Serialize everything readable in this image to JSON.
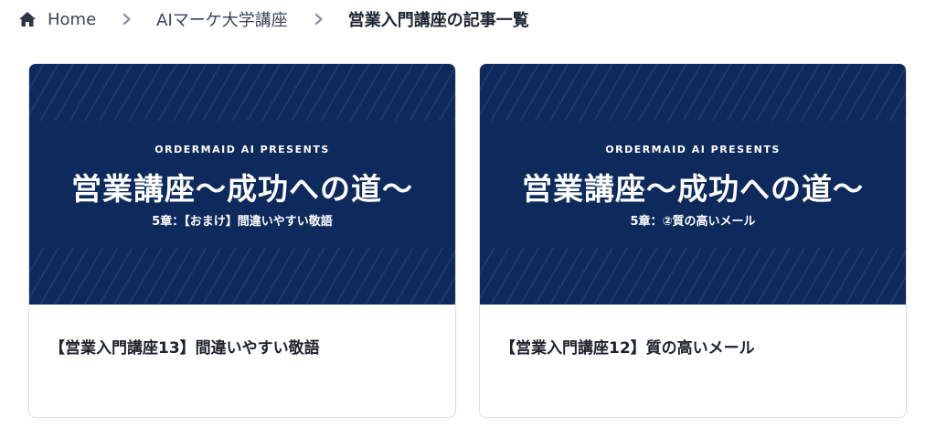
{
  "breadcrumb": {
    "home": "Home",
    "level1": "AIマーケ大学講座",
    "current": "営業入門講座の記事一覧"
  },
  "colors": {
    "thumbnail_bg": "#0e2a5c",
    "card_border": "#dcdfe4",
    "text": "#1e2229"
  },
  "cards": [
    {
      "presents": "ORDERMAID AI PRESENTS",
      "series": "営業講座〜成功への道〜",
      "chapter": "5章：【おまけ】間違いやすい敬語",
      "title": "【営業入門講座13】間違いやすい敬語"
    },
    {
      "presents": "ORDERMAID AI PRESENTS",
      "series": "営業講座〜成功への道〜",
      "chapter": "5章：②質の高いメール",
      "title": "【営業入門講座12】質の高いメール"
    }
  ]
}
